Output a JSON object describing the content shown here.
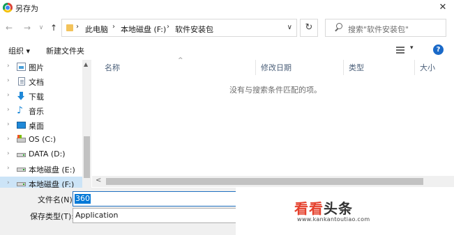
{
  "window": {
    "title": "另存为",
    "close_glyph": "✕"
  },
  "nav": {
    "back_glyph": "←",
    "forward_glyph": "→",
    "recent_glyph": "∨",
    "up_glyph": "↑"
  },
  "address": {
    "crumbs": [
      "此电脑",
      "本地磁盘 (F:)",
      "软件安装包"
    ],
    "separator": "›",
    "dropdown_glyph": "∨",
    "refresh_glyph": "↻"
  },
  "search": {
    "placeholder": "搜索\"软件安装包\""
  },
  "toolbar": {
    "organize": "组织 ▾",
    "new_folder": "新建文件夹",
    "view_caret": "▾",
    "help_glyph": "?"
  },
  "sidebar": {
    "items": [
      {
        "label": "图片",
        "icon": "pictures-icon"
      },
      {
        "label": "文档",
        "icon": "documents-icon"
      },
      {
        "label": "下载",
        "icon": "downloads-icon"
      },
      {
        "label": "音乐",
        "icon": "music-icon"
      },
      {
        "label": "桌面",
        "icon": "desktop-icon"
      },
      {
        "label": "OS (C:)",
        "icon": "os-drive-icon"
      },
      {
        "label": "DATA (D:)",
        "icon": "drive-icon"
      },
      {
        "label": "本地磁盘 (E:)",
        "icon": "drive-icon"
      },
      {
        "label": "本地磁盘 (F:)",
        "icon": "drive-icon",
        "selected": true
      }
    ],
    "chevron": "›",
    "music_glyph": "♪"
  },
  "columns": {
    "name": "名称",
    "date": "修改日期",
    "type": "类型",
    "size": "大小",
    "sort_glyph": "^"
  },
  "empty_message": "没有与搜索条件匹配的项。",
  "scroll": {
    "up_glyph": "▲",
    "left_glyph": "<"
  },
  "form": {
    "filename_label": "文件名(N):",
    "filename_value": "360",
    "filetype_label": "保存类型(T):",
    "filetype_value": "Application"
  },
  "watermark": {
    "logo_a": "看看",
    "logo_b": "头条",
    "url": "www.kankantoutiao.com"
  },
  "colors": {
    "accent": "#0078d7",
    "selected_bg": "#cce4f7",
    "watermark_red": "#e5412d"
  }
}
